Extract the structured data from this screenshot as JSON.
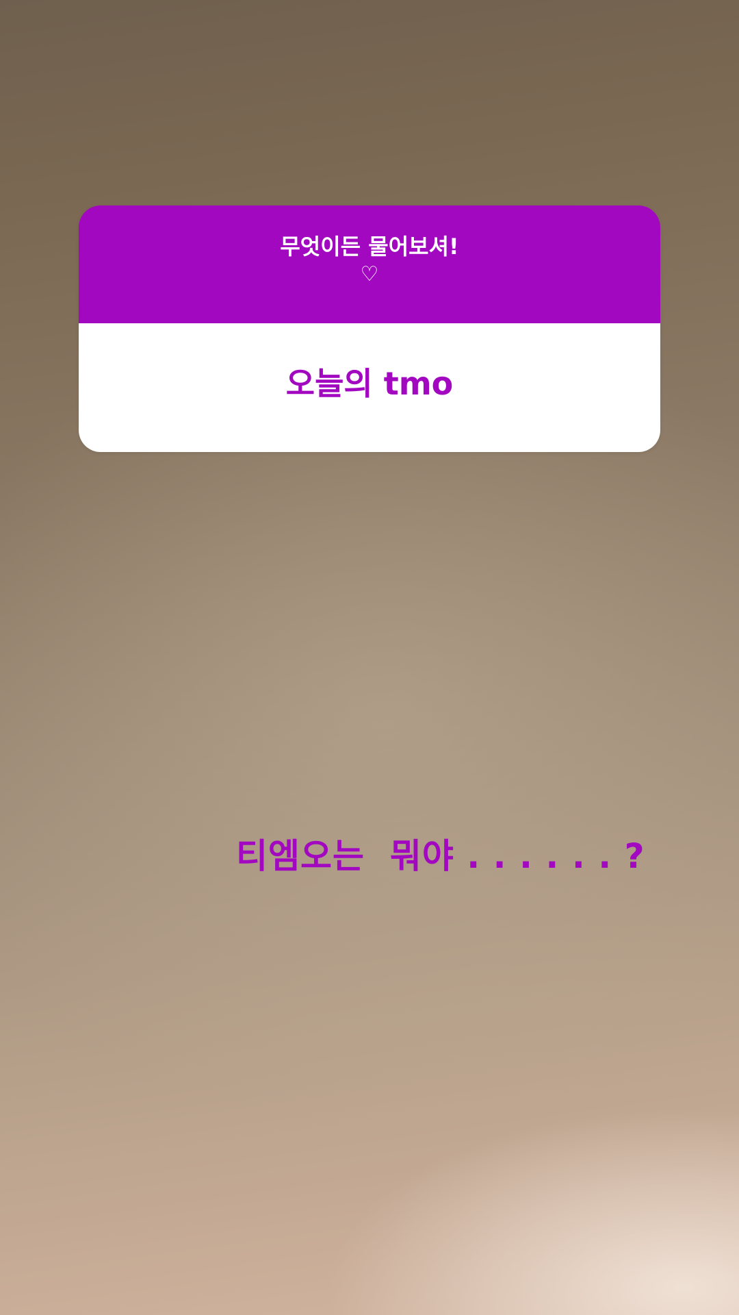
{
  "question_sticker": {
    "prompt": "무엇이든 물어보셔!",
    "heart_glyph": "♡",
    "answer": "오늘의 tmo",
    "accent_color": "#a108c0"
  },
  "caption": {
    "text": "티엠오는  뭐야 . . . . . . ?",
    "color": "#a108c0"
  }
}
